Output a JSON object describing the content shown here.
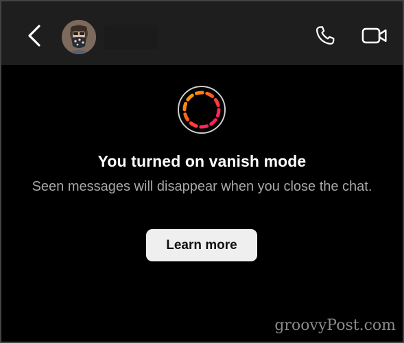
{
  "header": {
    "back_icon": "chevron-left-icon",
    "avatar": "contact-avatar",
    "call_icon": "phone-icon",
    "video_icon": "video-camera-icon"
  },
  "vanish": {
    "icon": "vanish-mode-ring-icon",
    "title": "You turned on vanish mode",
    "subtitle": "Seen messages will disappear when you close the chat.",
    "button_label": "Learn more"
  },
  "colors": {
    "header_bg": "#1e1e1e",
    "background": "#000000",
    "ring_start": "#ff9a00",
    "ring_end": "#ff0a6c",
    "subtitle": "#a8a8a8",
    "button_bg": "#efefef"
  },
  "watermark": "groovyPost.com"
}
